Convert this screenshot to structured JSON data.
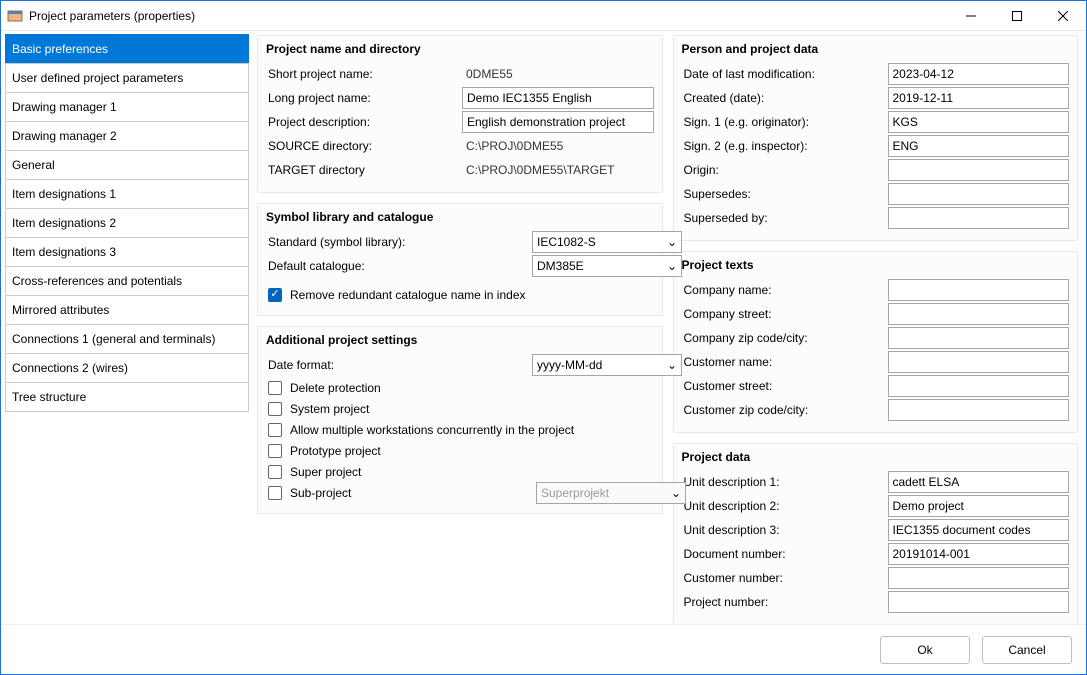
{
  "window": {
    "title": "Project parameters (properties)"
  },
  "sidebar": {
    "items": [
      {
        "label": "Basic preferences",
        "selected": true
      },
      {
        "label": "User defined project parameters"
      },
      {
        "label": "Drawing manager 1"
      },
      {
        "label": "Drawing manager 2"
      },
      {
        "label": "General"
      },
      {
        "label": "Item designations 1"
      },
      {
        "label": "Item designations 2"
      },
      {
        "label": "Item designations 3"
      },
      {
        "label": "Cross-references and potentials"
      },
      {
        "label": "Mirrored attributes"
      },
      {
        "label": "Connections 1 (general and terminals)"
      },
      {
        "label": "Connections 2 (wires)"
      },
      {
        "label": "Tree structure"
      }
    ]
  },
  "sections": {
    "projectNameDir": {
      "title": "Project name and directory",
      "shortName": {
        "label": "Short project name:",
        "value": "0DME55"
      },
      "longName": {
        "label": "Long project name:",
        "value": "Demo IEC1355 English"
      },
      "description": {
        "label": "Project description:",
        "value": "English demonstration project"
      },
      "sourceDir": {
        "label": "SOURCE directory:",
        "value": "C:\\PROJ\\0DME55"
      },
      "targetDir": {
        "label": "TARGET directory",
        "value": "C:\\PROJ\\0DME55\\TARGET"
      }
    },
    "symbolLib": {
      "title": "Symbol library and catalogue",
      "standard": {
        "label": "Standard (symbol library):",
        "value": "IEC1082-S"
      },
      "defaultCat": {
        "label": "Default catalogue:",
        "value": "DM385E"
      },
      "removeRedundant": {
        "label": "Remove redundant catalogue name in index",
        "checked": true
      }
    },
    "additional": {
      "title": "Additional project settings",
      "dateFormat": {
        "label": "Date format:",
        "value": "yyyy-MM-dd"
      },
      "deleteProtection": {
        "label": "Delete protection",
        "checked": false
      },
      "systemProject": {
        "label": "System project",
        "checked": false
      },
      "multiWorkstations": {
        "label": "Allow multiple workstations concurrently in the project",
        "checked": false
      },
      "prototype": {
        "label": "Prototype project",
        "checked": false
      },
      "superProject": {
        "label": "Super project",
        "checked": false
      },
      "subProject": {
        "label": "Sub-project",
        "checked": false
      },
      "subProjectSelect": {
        "value": "Superprojekt"
      }
    },
    "personProject": {
      "title": "Person and project data",
      "lastMod": {
        "label": "Date of last modification:",
        "value": "2023-04-12"
      },
      "created": {
        "label": "Created (date):",
        "value": "2019-12-11"
      },
      "sign1": {
        "label": "Sign. 1 (e.g. originator):",
        "value": "KGS"
      },
      "sign2": {
        "label": "Sign. 2 (e.g. inspector):",
        "value": "ENG"
      },
      "origin": {
        "label": "Origin:",
        "value": ""
      },
      "supersedes": {
        "label": "Supersedes:",
        "value": ""
      },
      "supersededBy": {
        "label": "Superseded by:",
        "value": ""
      }
    },
    "projectTexts": {
      "title": "Project texts",
      "companyName": {
        "label": "Company name:",
        "value": ""
      },
      "companyStreet": {
        "label": "Company street:",
        "value": ""
      },
      "companyZip": {
        "label": "Company zip code/city:",
        "value": ""
      },
      "customerName": {
        "label": "Customer name:",
        "value": ""
      },
      "customerStreet": {
        "label": "Customer street:",
        "value": ""
      },
      "customerZip": {
        "label": "Customer zip code/city:",
        "value": ""
      }
    },
    "projectData": {
      "title": "Project data",
      "unit1": {
        "label": "Unit description 1:",
        "value": "cadett ELSA"
      },
      "unit2": {
        "label": "Unit description 2:",
        "value": "Demo project"
      },
      "unit3": {
        "label": "Unit description 3:",
        "value": "IEC1355 document codes"
      },
      "docNumber": {
        "label": "Document number:",
        "value": "20191014-001"
      },
      "custNumber": {
        "label": "Customer number:",
        "value": ""
      },
      "projNumber": {
        "label": "Project number:",
        "value": ""
      }
    }
  },
  "footer": {
    "ok": "Ok",
    "cancel": "Cancel"
  }
}
